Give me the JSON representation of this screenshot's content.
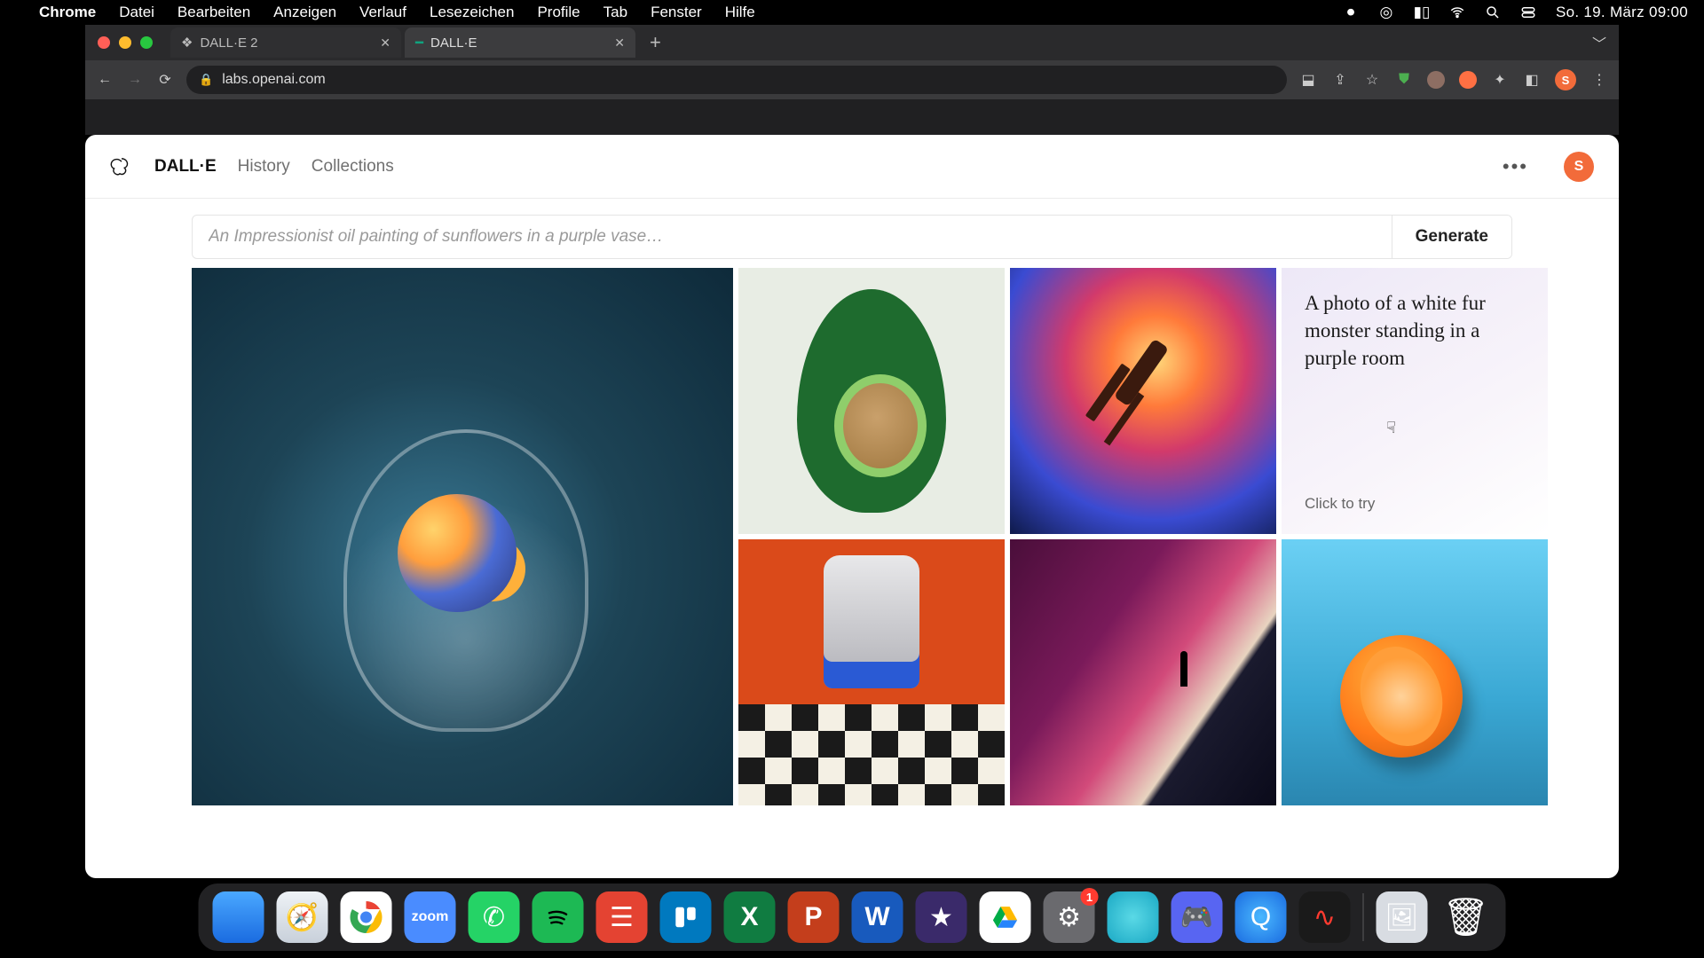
{
  "menubar": {
    "app": "Chrome",
    "items": [
      "Datei",
      "Bearbeiten",
      "Anzeigen",
      "Verlauf",
      "Lesezeichen",
      "Profile",
      "Tab",
      "Fenster",
      "Hilfe"
    ],
    "datetime": "So. 19. März  09:00"
  },
  "browser": {
    "tabs": [
      {
        "title": "DALL·E 2",
        "active": false
      },
      {
        "title": "DALL·E",
        "active": true
      }
    ],
    "url": "labs.openai.com"
  },
  "page": {
    "nav": {
      "brand": "DALL·E",
      "history": "History",
      "collections": "Collections"
    },
    "user_initial": "S",
    "prompt_placeholder": "An Impressionist oil painting of sunflowers in a purple vase…",
    "generate_label": "Generate",
    "try_card": {
      "prompt": "A photo of a white fur monster standing in a purple room",
      "cta": "Click to try"
    }
  },
  "dock": {
    "apps": [
      {
        "name": "finder",
        "bg": "linear-gradient(#4aa8ff,#1a6be0)"
      },
      {
        "name": "safari",
        "bg": "linear-gradient(#eef2f6,#c8d0da)"
      },
      {
        "name": "chrome",
        "bg": "#fff"
      },
      {
        "name": "zoom",
        "bg": "#4a8cff"
      },
      {
        "name": "whatsapp",
        "bg": "#25d366"
      },
      {
        "name": "spotify",
        "bg": "#1db954"
      },
      {
        "name": "todoist",
        "bg": "#e44332"
      },
      {
        "name": "trello",
        "bg": "#0079bf"
      },
      {
        "name": "excel",
        "bg": "#107c41"
      },
      {
        "name": "powerpoint",
        "bg": "#c43e1c"
      },
      {
        "name": "word",
        "bg": "#185abd"
      },
      {
        "name": "imovie",
        "bg": "#3a2a6a"
      },
      {
        "name": "drive",
        "bg": "#ffffff"
      },
      {
        "name": "settings",
        "bg": "#6a6a6e",
        "badge": "1"
      },
      {
        "name": "app-cyan",
        "bg": "radial-gradient(circle,#5ad9e6,#1aa8c4)"
      },
      {
        "name": "discord",
        "bg": "#5865f2"
      },
      {
        "name": "quicktime",
        "bg": "radial-gradient(circle,#4ab8ff,#1a6be0)"
      },
      {
        "name": "voice-memos",
        "bg": "#1a1a1a"
      }
    ],
    "right": [
      {
        "name": "preview",
        "bg": "#d8dce2"
      },
      {
        "name": "trash",
        "bg": "transparent"
      }
    ]
  }
}
